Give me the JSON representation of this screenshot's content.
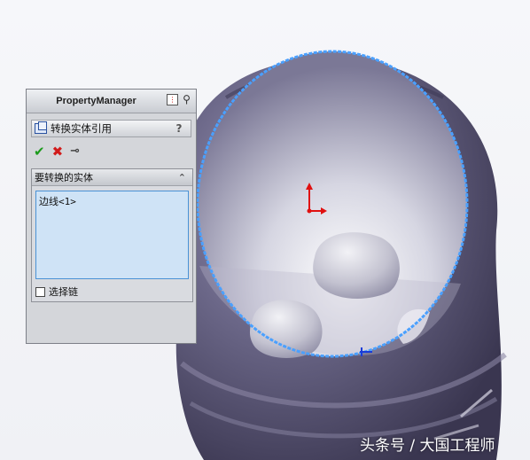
{
  "property_manager": {
    "title": "PropertyManager",
    "feature_title": "转换实体引用",
    "help_symbol": "?",
    "ok_symbol": "✔",
    "cancel_symbol": "✖",
    "pushpin_symbol": "⊸",
    "group_title": "要转换的实体",
    "collapse_symbol": "⌃",
    "selection_items": [
      "边线<1>"
    ],
    "chain_label": "选择链",
    "chain_checked": false
  },
  "watermark": "头条号 / 大国工程师",
  "colors": {
    "part_body": "#5f5b78",
    "edge_highlight": "#4aa0ff",
    "origin_axis": "#e01010",
    "selection_bg": "#cfe3f6"
  },
  "icons": [
    "feature-convert-entities-icon",
    "ok-check-icon",
    "cancel-x-icon",
    "pushpin-icon",
    "help-icon",
    "collapse-icon",
    "pin-icon",
    "sketch-origin-icon"
  ]
}
